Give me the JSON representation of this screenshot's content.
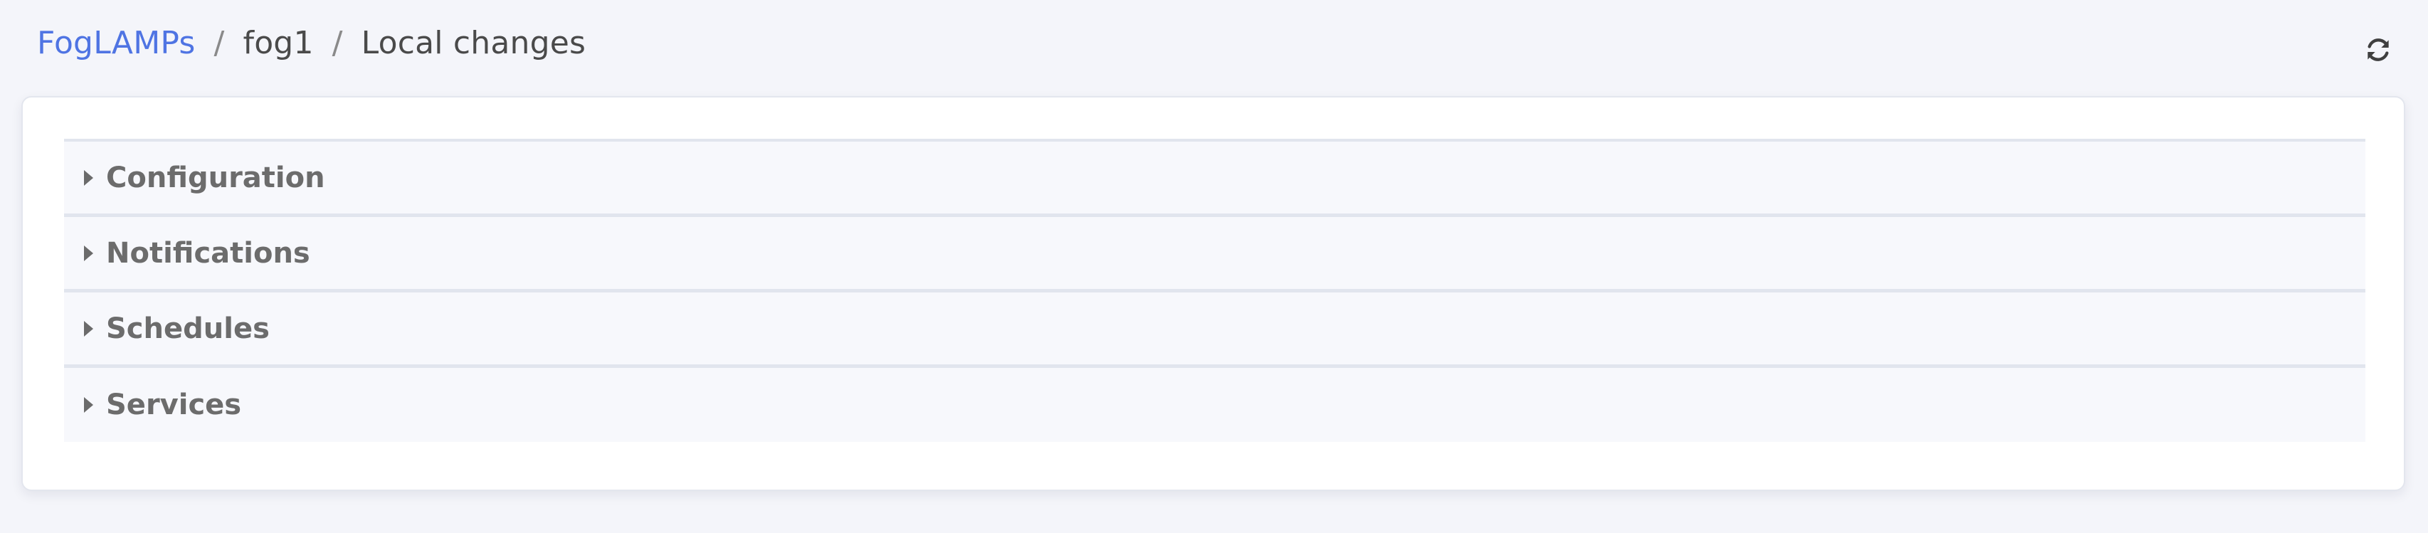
{
  "breadcrumb": {
    "root": "FogLAMPs",
    "separator": "/",
    "instance": "fog1",
    "current": "Local changes"
  },
  "toolbar": {
    "refresh_icon": "refresh-icon"
  },
  "sections": [
    {
      "label": "Configuration",
      "icon": "caret-right-icon"
    },
    {
      "label": "Notifications",
      "icon": "caret-right-icon"
    },
    {
      "label": "Schedules",
      "icon": "caret-right-icon"
    },
    {
      "label": "Services",
      "icon": "caret-right-icon"
    }
  ],
  "colors": {
    "background": "#f4f5fa",
    "link": "#4f74e3",
    "card": "#ffffff",
    "accordion": "#f7f8fc",
    "text_muted": "#6c6c6c"
  }
}
